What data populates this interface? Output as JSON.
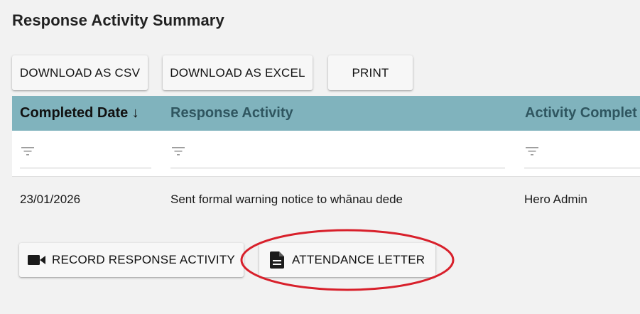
{
  "page": {
    "title": "Response Activity Summary"
  },
  "toolbar": {
    "download_csv_label": "DOWNLOAD AS CSV",
    "download_excel_label": "DOWNLOAD AS EXCEL",
    "print_label": "PRINT"
  },
  "table": {
    "columns": [
      {
        "label": "Completed Date ↓",
        "sorted": "desc"
      },
      {
        "label": "Response Activity"
      },
      {
        "label": "Activity Complet"
      }
    ],
    "rows": [
      [
        "23/01/2026",
        "Sent formal warning notice to whānau dede",
        "Hero Admin"
      ]
    ]
  },
  "actions": {
    "record_label": "RECORD RESPONSE ACTIVITY",
    "record_icon": "video-camera-icon",
    "letter_label": "ATTENDANCE LETTER",
    "letter_icon": "document-icon"
  },
  "colors": {
    "header_bg": "#80b3bd",
    "header_text": "#2f5660",
    "annotation_ellipse": "#d8202b"
  }
}
